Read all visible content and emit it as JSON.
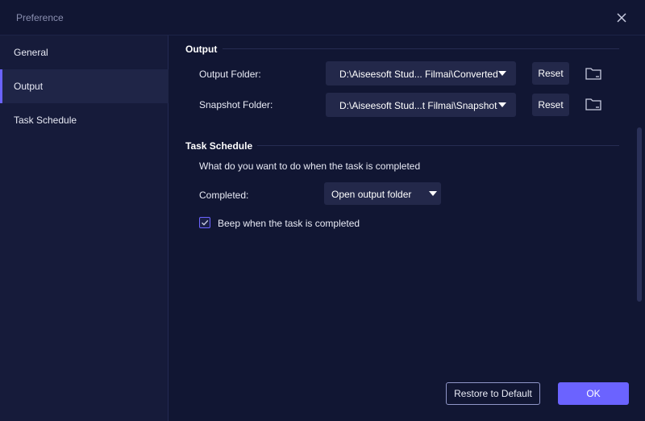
{
  "window": {
    "title": "Preference",
    "close_icon": "close-icon"
  },
  "sidebar": {
    "items": [
      {
        "label": "General",
        "active": false
      },
      {
        "label": "Output",
        "active": true
      },
      {
        "label": "Task Schedule",
        "active": false
      }
    ]
  },
  "output": {
    "section_title": "Output",
    "output_folder": {
      "label": "Output Folder:",
      "value": "D:\\Aiseesoft Stud... Filmai\\Converted",
      "reset_label": "Reset",
      "folder_icon": "folder-icon"
    },
    "snapshot_folder": {
      "label": "Snapshot Folder:",
      "value": "D:\\Aiseesoft Stud...t Filmai\\Snapshot",
      "reset_label": "Reset",
      "folder_icon": "folder-icon"
    }
  },
  "task_schedule": {
    "section_title": "Task Schedule",
    "question": "What do you want to do when the task is completed",
    "completed_label": "Completed:",
    "completed_value": "Open output folder",
    "beep_label": "Beep when the task is completed",
    "beep_checked": true
  },
  "footer": {
    "restore_label": "Restore to Default",
    "ok_label": "OK"
  },
  "colors": {
    "accent": "#6b63ff",
    "background": "#111633",
    "sidebar": "#161b3a",
    "control": "#23284a"
  }
}
